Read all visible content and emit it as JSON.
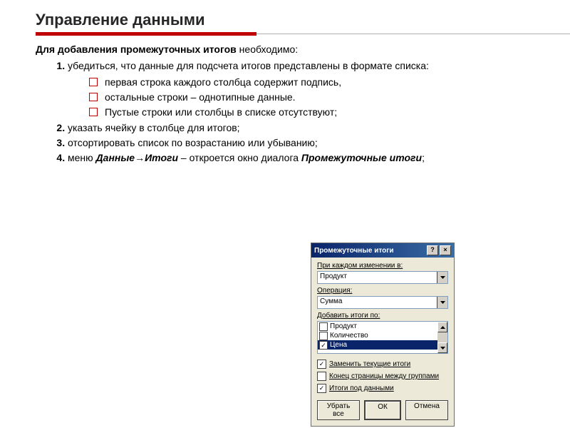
{
  "slide": {
    "title": "Управление данными",
    "intro": {
      "strong": "Для добавления промежуточных итогов",
      "tail": " необходимо:"
    },
    "item1": "убедиться, что данные для подсчета итогов представлены в формате списка:",
    "sub1": [
      "первая строка каждого столбца содержит подпись,",
      "остальные строки – однотипные данные.",
      "Пустые строки или столбцы в списке отсутствуют;"
    ],
    "item2": "указать ячейку в столбце для итогов;",
    "item3": "отсортировать список по возрастанию или убыванию;",
    "item4": {
      "p1": "меню ",
      "p2": "Данные",
      "arrow": "→",
      "p3": "Итоги",
      "p4": " – откроется окно диалога ",
      "p5": "Промежуточные итоги",
      "p6": ";"
    }
  },
  "dialog": {
    "title": "Промежуточные итоги",
    "help": "?",
    "close": "×",
    "label_change": "При каждом изменении в:",
    "combo_change": "Продукт",
    "label_op": "Операция:",
    "combo_op": "Сумма",
    "label_add": "Добавить итоги по:",
    "list_items": {
      "a": "Продукт",
      "b": "Количество",
      "c": "Цена"
    },
    "chk_replace": "Заменить текущие итоги",
    "chk_pagebreak": "Конец страницы между группами",
    "chk_below": "Итоги под данными",
    "btn_removeall": "Убрать все",
    "btn_ok": "ОК",
    "btn_cancel": "Отмена"
  }
}
